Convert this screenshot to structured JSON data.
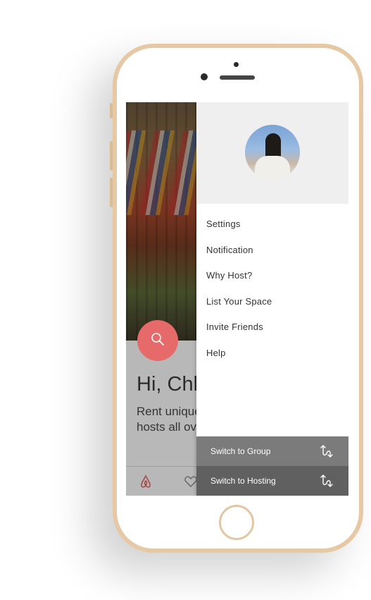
{
  "background_app": {
    "greeting": "Hi, Chl",
    "subtitle_line1": "Rent unique",
    "subtitle_line2": "hosts all ove"
  },
  "drawer": {
    "menu": [
      {
        "label": "Settings"
      },
      {
        "label": "Notification"
      },
      {
        "label": "Why Host?"
      },
      {
        "label": "List Your Space"
      },
      {
        "label": "Invite Friends"
      },
      {
        "label": "Help"
      }
    ],
    "switch_group_label": "Switch to Group",
    "switch_hosting_label": "Switch to Hosting"
  },
  "colors": {
    "accent": "#e76a6a",
    "switch_group_bg": "#7b7b7b",
    "switch_hosting_bg": "#606060",
    "phone_gold": "#e6c9a4"
  },
  "icons": [
    "search-icon",
    "airbnb-logo-icon",
    "heart-icon",
    "switch-arrows-icon"
  ]
}
